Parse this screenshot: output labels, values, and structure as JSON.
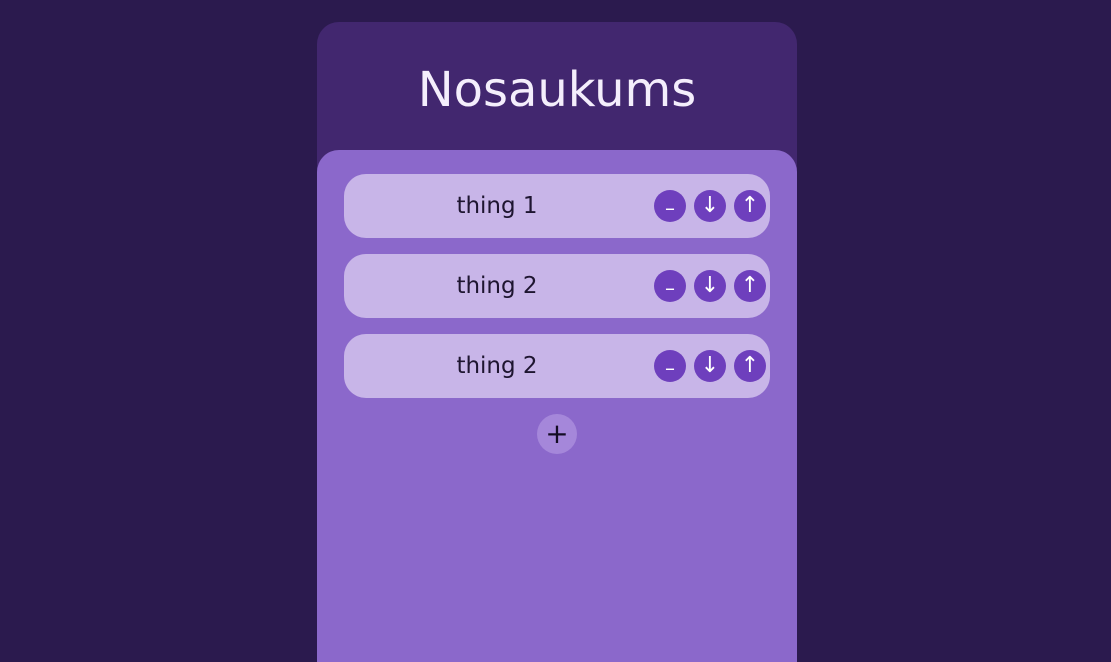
{
  "header": {
    "title": "Nosaukums"
  },
  "items": [
    {
      "label": "thing 1",
      "remove_icon": "–",
      "down_icon": "↓",
      "up_icon": "↑"
    },
    {
      "label": "thing 2",
      "remove_icon": "–",
      "down_icon": "↓",
      "up_icon": "↑"
    },
    {
      "label": "thing 2",
      "remove_icon": "–",
      "down_icon": "↓",
      "up_icon": "↑"
    }
  ],
  "add_button": {
    "icon": "+"
  },
  "colors": {
    "background": "#2b1a4e",
    "card": "#42276f",
    "panel": "#8b68cb",
    "item": "#c8b5e8",
    "action_button": "#6e3fbd",
    "add_button": "#a587da"
  }
}
